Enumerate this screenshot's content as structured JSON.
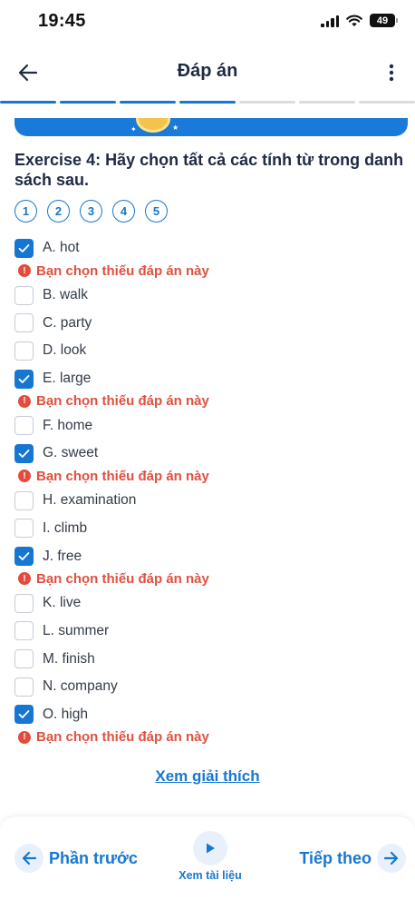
{
  "status": {
    "time": "19:45",
    "battery": "49"
  },
  "header": {
    "title": "Đáp án",
    "progress": {
      "total_segments": 7,
      "completed": 4
    }
  },
  "exercise": {
    "title": "Exercise 4: Hãy chọn tất cả các tính từ trong danh sách sau.",
    "questions": [
      "1",
      "2",
      "3",
      "4",
      "5"
    ]
  },
  "options": [
    {
      "label": "A. hot",
      "checked": true,
      "warning": "Bạn chọn thiếu đáp án này"
    },
    {
      "label": "B. walk",
      "checked": false
    },
    {
      "label": "C. party",
      "checked": false
    },
    {
      "label": "D. look",
      "checked": false
    },
    {
      "label": "E. large",
      "checked": true,
      "warning": "Bạn chọn thiếu đáp án này"
    },
    {
      "label": "F. home",
      "checked": false
    },
    {
      "label": "G. sweet",
      "checked": true,
      "warning": "Bạn chọn thiếu đáp án này"
    },
    {
      "label": "H. examination",
      "checked": false
    },
    {
      "label": "I. climb",
      "checked": false
    },
    {
      "label": "J. free",
      "checked": true,
      "warning": "Bạn chọn thiếu đáp án này"
    },
    {
      "label": "K. live",
      "checked": false
    },
    {
      "label": "L. summer",
      "checked": false
    },
    {
      "label": "M. finish",
      "checked": false
    },
    {
      "label": "N. company",
      "checked": false
    },
    {
      "label": "O. high",
      "checked": true,
      "warning": "Bạn chọn thiếu đáp án này"
    }
  ],
  "explain_link": "Xem giải thích",
  "footer": {
    "prev_label": "Phần trước",
    "docs_label": "Xem tài liệu",
    "next_label": "Tiếp theo"
  },
  "colors": {
    "accent": "#1677d2",
    "warning": "#e0503f",
    "text": "#1f2a44"
  },
  "icons": {
    "back": "arrow-left-icon",
    "more": "more-vertical-icon",
    "check": "check-icon",
    "warning": "exclamation-circle-icon",
    "play": "play-icon",
    "prev": "arrow-left-icon",
    "next": "arrow-right-icon",
    "signal": "signal-icon",
    "wifi": "wifi-icon",
    "battery": "battery-icon"
  }
}
